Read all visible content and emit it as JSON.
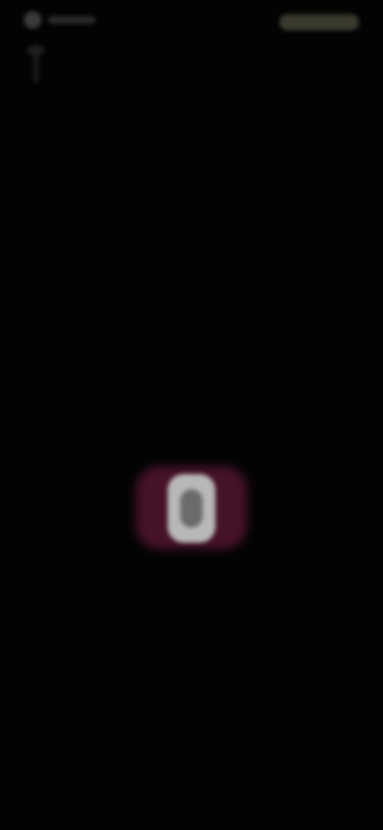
{
  "center": {
    "glyph": "0"
  },
  "colors": {
    "background": "#030303",
    "accent_glow": "#6a1a3e",
    "glyph": "#b8b8b8",
    "status_right": "#3b3a2e"
  },
  "icons": {
    "status_left": "status-icon",
    "back": "back-arrow-icon"
  }
}
